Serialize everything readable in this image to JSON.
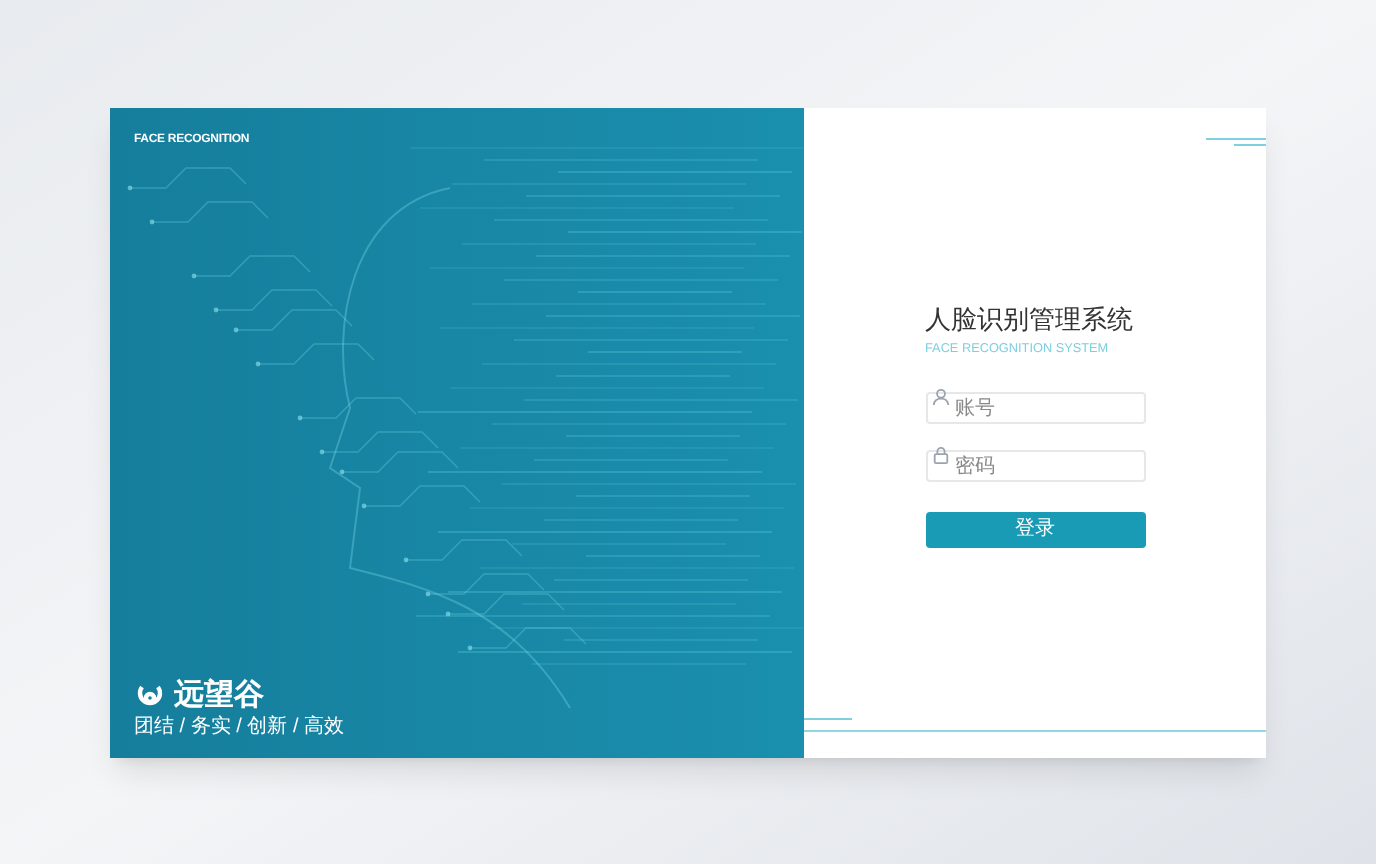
{
  "banner": {
    "caption": "FACE RECOGNITION",
    "brand": "远望谷",
    "slogan": "团结 / 务实 / 创新 / 高效"
  },
  "login": {
    "title": "人脸识别管理系统",
    "subtitle": "FACE RECOGNITION SYSTEM",
    "fields": [
      {
        "kind": "user",
        "placeholder": "账号"
      },
      {
        "kind": "lock",
        "placeholder": "密码"
      }
    ],
    "submit": "登录"
  }
}
